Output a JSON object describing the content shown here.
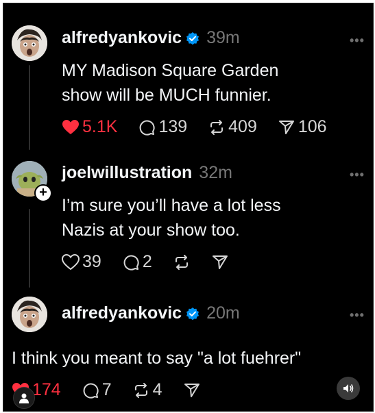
{
  "colors": {
    "background": "#000000",
    "text": "#f3f5f7",
    "muted": "#777777",
    "like": "#ff3040",
    "verified": "#0095f6"
  },
  "more_label": "•••",
  "posts": [
    {
      "username": "alfredyankovic",
      "verified": true,
      "time": "39m",
      "text_lines": [
        "MY Madison Square Garden",
        "show will be MUCH funnier."
      ],
      "likes": "5.1K",
      "liked": true,
      "replies": "139",
      "reposts": "409",
      "shares": "106",
      "avatar_icon": "avatar-alfredyankovic"
    },
    {
      "username": "joelwillustration",
      "verified": false,
      "time": "32m",
      "text_lines": [
        "I’m sure you’ll have a lot less",
        "Nazis at your show too."
      ],
      "likes": "39",
      "liked": false,
      "replies": "2",
      "reposts": "",
      "shares": "",
      "follow_icon": "plus-icon",
      "avatar_icon": "avatar-joelwillustration"
    },
    {
      "username": "alfredyankovic",
      "verified": true,
      "time": "20m",
      "text_lines": [
        "I think you meant to say \"a lot fuehrer\""
      ],
      "likes": "174",
      "liked": true,
      "replies": "7",
      "reposts": "4",
      "shares": "",
      "avatar_icon": "avatar-alfredyankovic"
    }
  ],
  "overlay": {
    "sound_icon": "speaker-icon",
    "profile_icon": "profile-icon"
  }
}
